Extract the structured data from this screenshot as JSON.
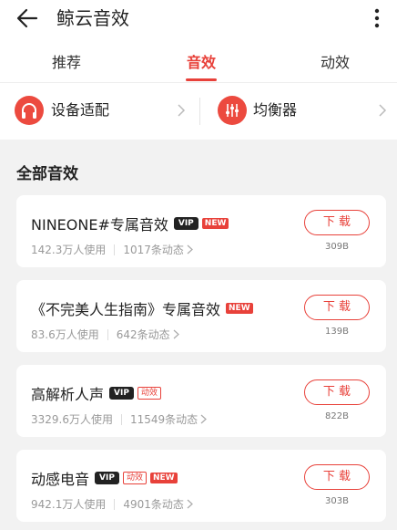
{
  "header": {
    "title": "鲸云音效"
  },
  "tabs": [
    {
      "label": "推荐"
    },
    {
      "label": "音效"
    },
    {
      "label": "动效"
    }
  ],
  "quick": [
    {
      "label": "设备适配",
      "icon": "headphones-icon"
    },
    {
      "label": "均衡器",
      "icon": "equalizer-icon"
    }
  ],
  "section_title": "全部音效",
  "cards": [
    {
      "name": "NINEONE#专属音效",
      "badges": [
        "VIP",
        "NEW"
      ],
      "users": "142.3万人使用",
      "posts": "1017条动态",
      "download": "下 载",
      "size": "309B"
    },
    {
      "name": "《不完美人生指南》专属音效",
      "badges": [
        "NEW"
      ],
      "users": "83.6万人使用",
      "posts": "642条动态",
      "download": "下 载",
      "size": "139B"
    },
    {
      "name": "高解析人声",
      "badges": [
        "VIP",
        "动效"
      ],
      "users": "3329.6万人使用",
      "posts": "11549条动态",
      "download": "下 载",
      "size": "822B"
    },
    {
      "name": "动感电音",
      "badges": [
        "VIP",
        "动效",
        "NEW"
      ],
      "users": "942.1万人使用",
      "posts": "4901条动态",
      "download": "下 载",
      "size": "303B"
    }
  ],
  "colors": {
    "accent": "#e8413a"
  }
}
